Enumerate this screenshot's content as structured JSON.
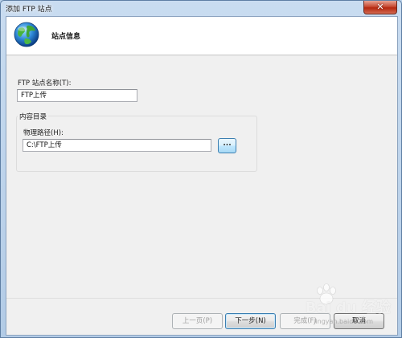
{
  "window": {
    "title": "添加 FTP 站点",
    "close_glyph": "✕"
  },
  "header": {
    "icon": "globe-icon",
    "title": "站点信息"
  },
  "form": {
    "site_name_label": "FTP 站点名称(T):",
    "site_name_value": "FTP上传",
    "content_group_label": "内容目录",
    "physical_path_label": "物理路径(H):",
    "physical_path_value": "C:\\FTP上传",
    "browse_label": "..."
  },
  "buttons": {
    "previous": "上一页(P)",
    "next": "下一步(N)",
    "finish": "完成(F)",
    "cancel": "取消"
  },
  "watermark": {
    "brand": "Bai du 经验",
    "site": "jingyan.baidu.com"
  },
  "colors": {
    "accent": "#3c7fb1",
    "close": "#c74b33"
  }
}
